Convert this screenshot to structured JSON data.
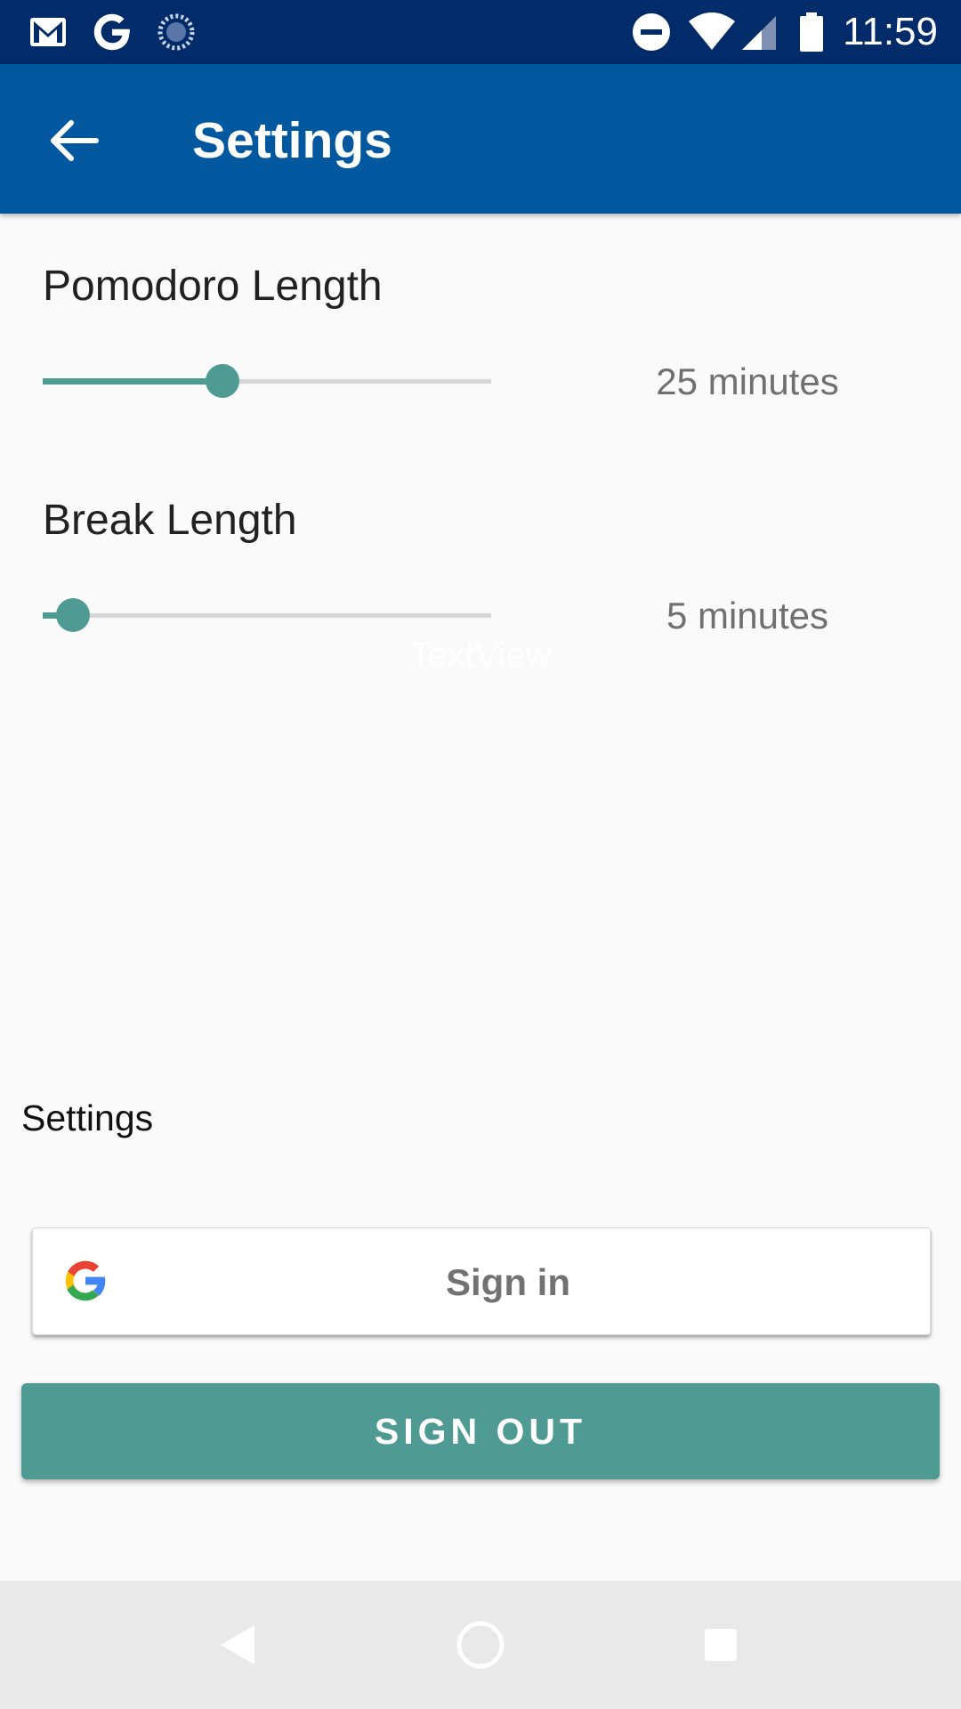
{
  "status_bar": {
    "time": "11:59",
    "left_icons": [
      "gmail-icon",
      "google-icon",
      "sync-icon"
    ],
    "right_icons": [
      "do-not-disturb-icon",
      "wifi-icon",
      "cell-signal-icon",
      "battery-icon"
    ],
    "background": "#022b6a"
  },
  "app_bar": {
    "title": "Settings",
    "back_icon": "arrow-left-icon",
    "background": "#02589f"
  },
  "settings": {
    "pomodoro": {
      "label": "Pomodoro Length",
      "value_text": "25 minutes",
      "slider_fraction": 0.4
    },
    "break": {
      "label": "Break Length",
      "value_text": "5 minutes",
      "slider_fraction": 0.067
    },
    "textview_placeholder": "TextView",
    "accent_color": "#4f9b93"
  },
  "footer": {
    "settings_label": "Settings",
    "google_sign_in_label": "Sign in",
    "sign_out_label": "SIGN OUT"
  },
  "nav_bar": {
    "buttons": [
      "back-nav-icon",
      "home-nav-icon",
      "recents-nav-icon"
    ]
  }
}
